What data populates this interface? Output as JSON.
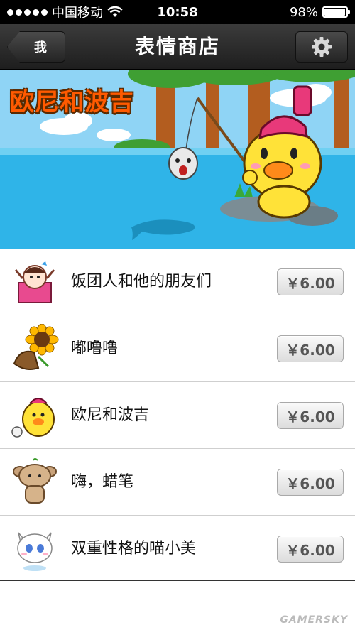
{
  "status_bar": {
    "carrier": "中国移动",
    "time": "10:58",
    "battery": "98%",
    "battery_level": 0.98
  },
  "nav": {
    "back_label": "我",
    "title": "表情商店",
    "settings_icon": "gear-icon"
  },
  "banner": {
    "title": "欧尼和波吉"
  },
  "stickers": [
    {
      "name": "饭团人和他的朋友们",
      "price": "￥6.00"
    },
    {
      "name": "嘟噜噜",
      "price": "￥6.00"
    },
    {
      "name": "欧尼和波吉",
      "price": "￥6.00"
    },
    {
      "name": "嗨，蜡笔",
      "price": "￥6.00"
    },
    {
      "name": "双重性格的喵小美",
      "price": "￥6.00"
    }
  ],
  "watermark": "GAMERSKY"
}
